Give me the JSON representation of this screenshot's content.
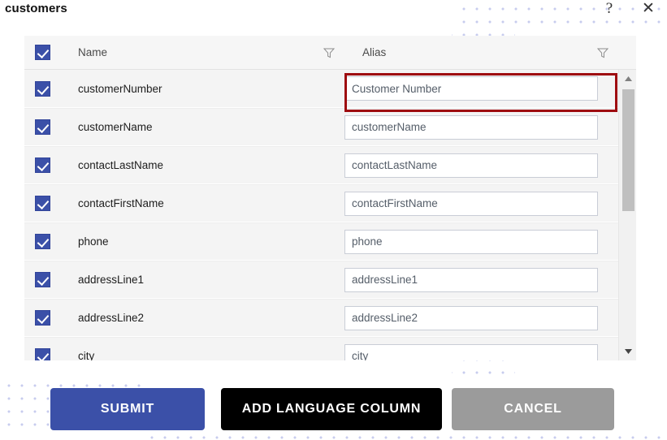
{
  "window": {
    "title": "customers",
    "help_icon": "question-mark",
    "close_icon": "close-x",
    "help_glyph": "?",
    "close_glyph": "✕"
  },
  "grid": {
    "select_all_checked": true,
    "columns": [
      {
        "key": "check",
        "label": "",
        "filter": false
      },
      {
        "key": "name",
        "label": "Name",
        "filter": true,
        "filter_icon": "filter-icon"
      },
      {
        "key": "alias",
        "label": "Alias",
        "filter": true,
        "filter_icon": "filter-icon"
      }
    ],
    "rows": [
      {
        "checked": true,
        "name": "customerNumber",
        "alias": "Customer Number",
        "highlighted": true
      },
      {
        "checked": true,
        "name": "customerName",
        "alias": "customerName",
        "highlighted": false
      },
      {
        "checked": true,
        "name": "contactLastName",
        "alias": "contactLastName",
        "highlighted": false
      },
      {
        "checked": true,
        "name": "contactFirstName",
        "alias": "contactFirstName",
        "highlighted": false
      },
      {
        "checked": true,
        "name": "phone",
        "alias": "phone",
        "highlighted": false
      },
      {
        "checked": true,
        "name": "addressLine1",
        "alias": "addressLine1",
        "highlighted": false
      },
      {
        "checked": true,
        "name": "addressLine2",
        "alias": "addressLine2",
        "highlighted": false
      },
      {
        "checked": true,
        "name": "city",
        "alias": "city",
        "highlighted": false
      }
    ],
    "scrollbar": {
      "up_arrow_icon": "scroll-up-arrow",
      "down_arrow_icon": "scroll-down-arrow",
      "thumb_position_percent": 0,
      "thumb_size_percent": 45
    }
  },
  "footer": {
    "submit_label": "SUBMIT",
    "add_language_column_label": "ADD LANGUAGE COLUMN",
    "cancel_label": "CANCEL"
  },
  "colors": {
    "accent_blue": "#3b50a8",
    "black_button": "#000000",
    "gray_button": "#9b9b9b",
    "annotation_red": "#9e0b10",
    "dot_pattern": "#9aa3e0",
    "row_background": "#f4f4f4",
    "header_background": "#f6f6f6"
  }
}
